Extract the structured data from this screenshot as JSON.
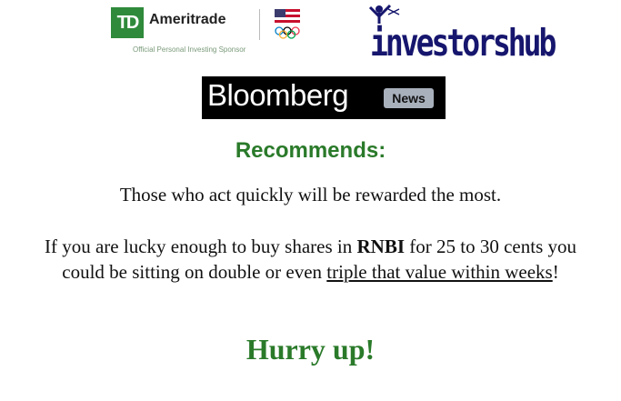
{
  "logos": {
    "td_mark": "TD",
    "td_name": "Ameritrade",
    "td_sponsor": "Official Personal Investing Sponsor",
    "investorshub": "investorshub",
    "bloomberg": "Bloomberg",
    "bloomberg_badge": "News"
  },
  "heading": "Recommends:",
  "line1": "Those who act quickly will be rewarded the most.",
  "paragraph": {
    "part1": "If you are lucky enough to buy shares in ",
    "ticker": "RNBI",
    "part2": " for 25 to 30 cents you could be sitting on double or even ",
    "underlined": "triple that value within weeks",
    "part3": "!"
  },
  "cta": "Hurry up!",
  "colors": {
    "td_green": "#2f8a3b",
    "headline_green": "#2a7a2a",
    "investorshub_navy": "#16166e",
    "bloomberg_black": "#000000",
    "news_badge": "#a8b0bc"
  }
}
